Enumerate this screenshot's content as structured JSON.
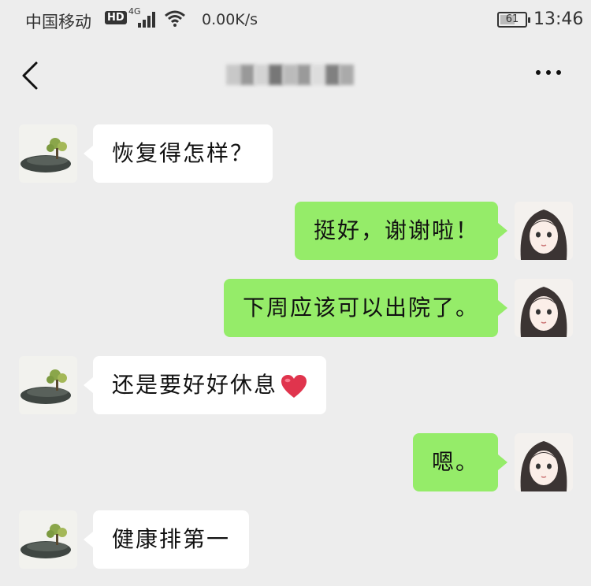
{
  "status_bar": {
    "carrier": "中国移动",
    "hd_badge": "HD",
    "network": "4G",
    "speed": "0.00K/s",
    "battery": "61",
    "time": "13:46"
  },
  "header": {
    "back_icon": "chevron-left-icon",
    "title": "",
    "more_icon": "more-horizontal-icon"
  },
  "messages": [
    {
      "side": "in",
      "text": "恢复得怎样？"
    },
    {
      "side": "out",
      "text": "挺好，谢谢啦！"
    },
    {
      "side": "out",
      "text": "下周应该可以出院了。"
    },
    {
      "side": "in",
      "text": "还是要好好休息",
      "emoji": "heart-icon"
    },
    {
      "side": "out",
      "text": "嗯。"
    },
    {
      "side": "in",
      "text": "健康排第一"
    }
  ],
  "colors": {
    "background": "#ededed",
    "incoming_bubble": "#ffffff",
    "outgoing_bubble": "#95ec69",
    "heart": "#e0344d"
  }
}
